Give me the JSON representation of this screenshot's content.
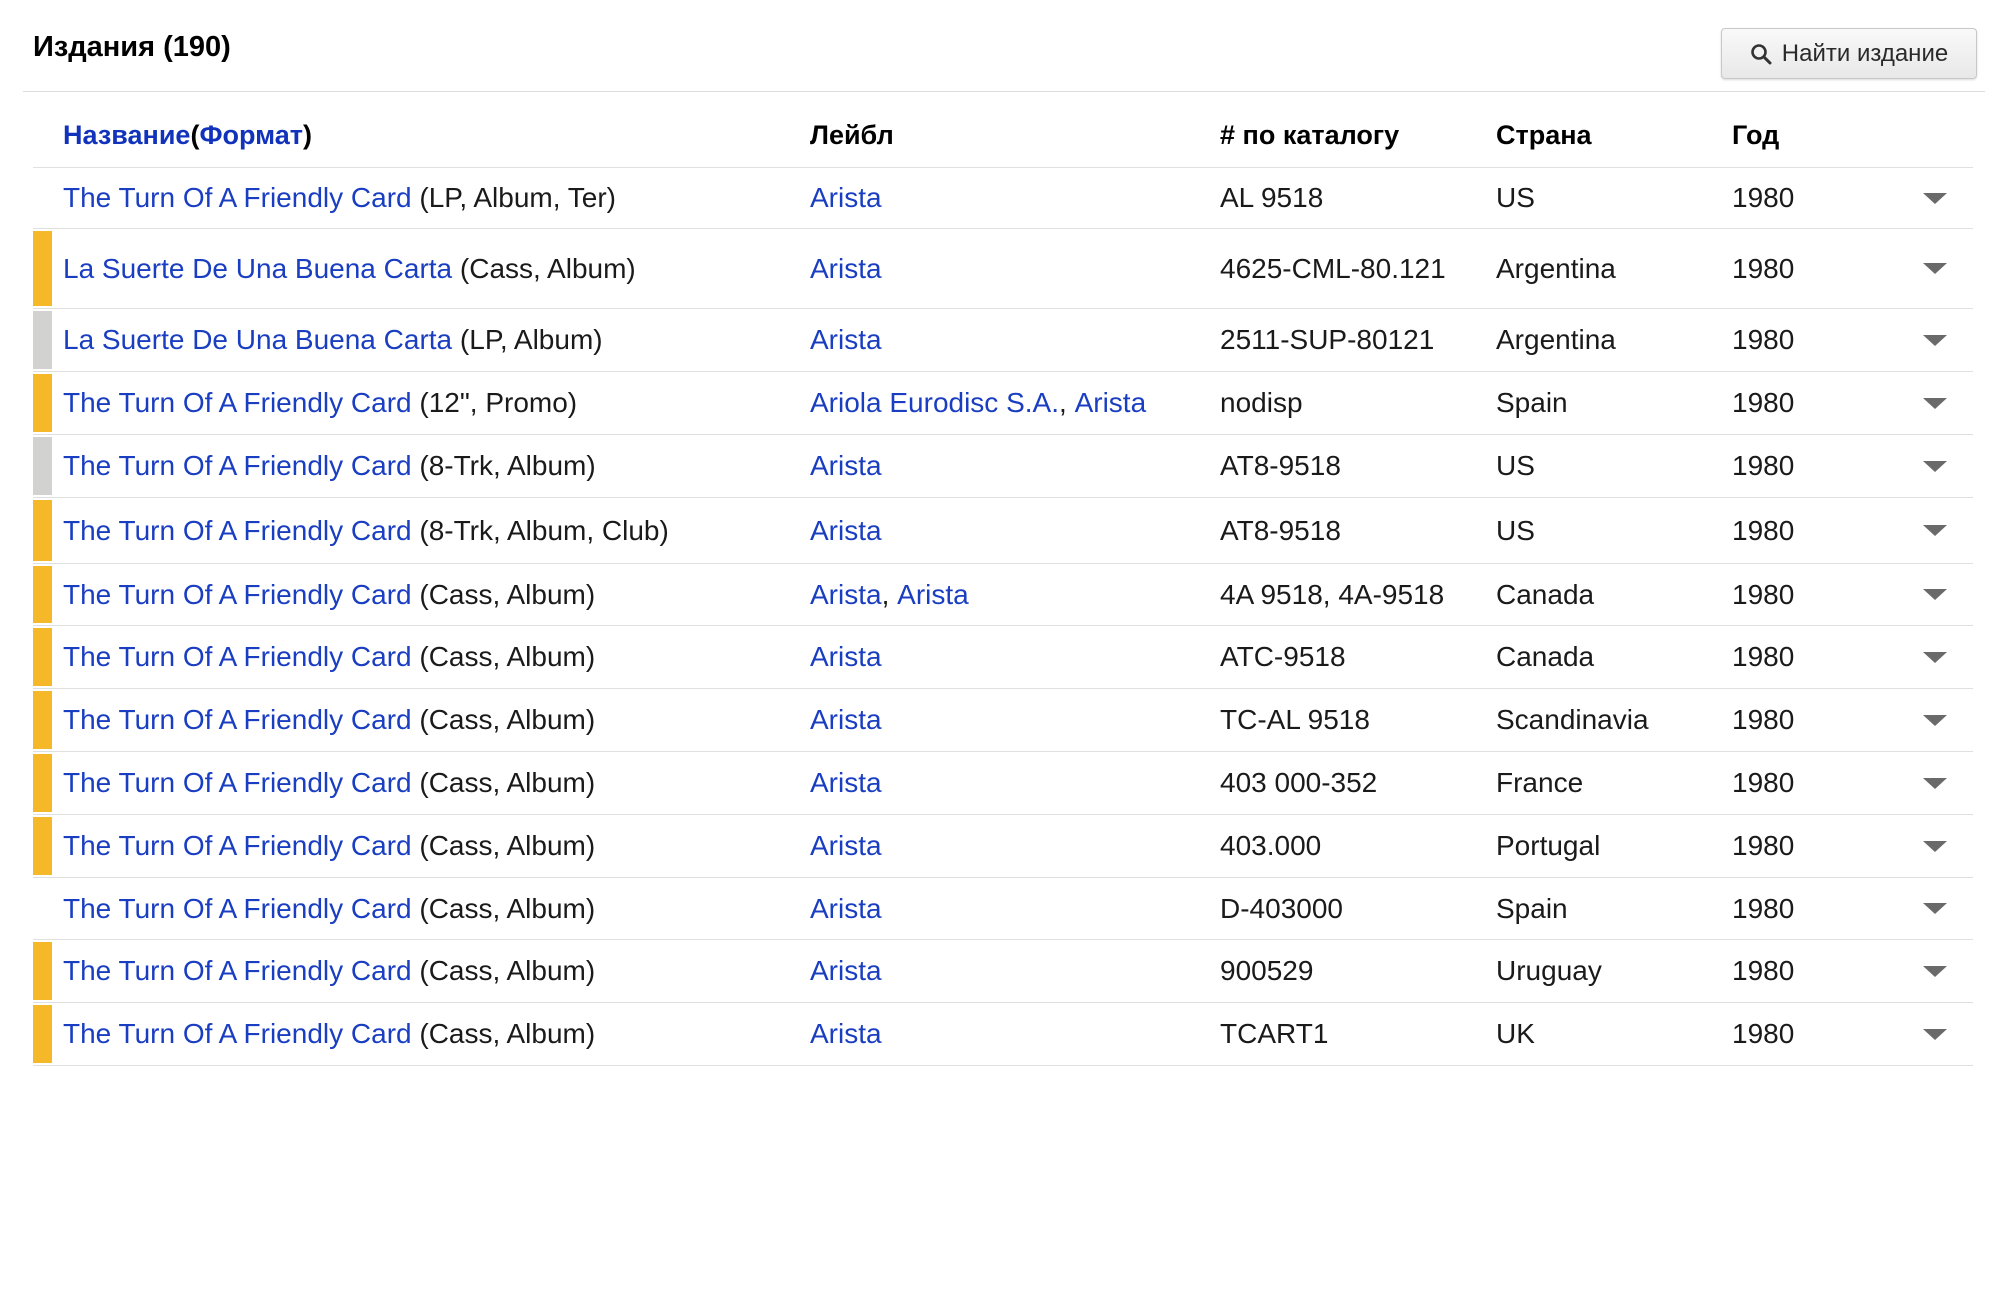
{
  "header": {
    "title": "Издания (190)",
    "find_button": "Найти издание",
    "find_icon": "search-icon"
  },
  "colors": {
    "link": "#1a3ec1",
    "stripe_yellow": "#f4b829",
    "stripe_gray": "#d2d2d0"
  },
  "columns": {
    "title": "Название",
    "title_open": " (",
    "format": "Формат",
    "title_close": ")",
    "label": "Лейбл",
    "catalog": "# по каталогу",
    "country": "Страна",
    "year": "Год"
  },
  "rows": [
    {
      "title": "The Turn Of A Friendly Card",
      "format": "(LP, Album, Ter)",
      "labels": [
        "Arista"
      ],
      "catalog": "AL 9518",
      "country": "US",
      "year": "1980",
      "stripe": "none"
    },
    {
      "title": "La Suerte De Una Buena Carta",
      "format": "(Cass, Album)",
      "labels": [
        "Arista"
      ],
      "catalog": "4625-CML-80.121",
      "country": "Argentina",
      "year": "1980",
      "stripe": "yellow"
    },
    {
      "title": "La Suerte De Una Buena Carta",
      "format": "(LP, Album)",
      "labels": [
        "Arista"
      ],
      "catalog": "2511-SUP-80121",
      "country": "Argentina",
      "year": "1980",
      "stripe": "gray"
    },
    {
      "title": "The Turn Of A Friendly Card",
      "format": "(12\", Promo)",
      "labels": [
        "Ariola Eurodisc S.A.",
        "Arista"
      ],
      "catalog": "nodisp",
      "country": "Spain",
      "year": "1980",
      "stripe": "yellow"
    },
    {
      "title": "The Turn Of A Friendly Card",
      "format": "(8-Trk, Album)",
      "labels": [
        "Arista"
      ],
      "catalog": "AT8-9518",
      "country": "US",
      "year": "1980",
      "stripe": "gray"
    },
    {
      "title": "The Turn Of A Friendly Card",
      "format": "(8-Trk, Album, Club)",
      "labels": [
        "Arista"
      ],
      "catalog": "AT8-9518",
      "country": "US",
      "year": "1980",
      "stripe": "yellow"
    },
    {
      "title": "The Turn Of A Friendly Card",
      "format": "(Cass, Album)",
      "labels": [
        "Arista",
        "Arista"
      ],
      "catalog": "4A 9518, 4A-9518",
      "country": "Canada",
      "year": "1980",
      "stripe": "yellow"
    },
    {
      "title": "The Turn Of A Friendly Card",
      "format": "(Cass, Album)",
      "labels": [
        "Arista"
      ],
      "catalog": "ATC-9518",
      "country": "Canada",
      "year": "1980",
      "stripe": "yellow"
    },
    {
      "title": "The Turn Of A Friendly Card",
      "format": "(Cass, Album)",
      "labels": [
        "Arista"
      ],
      "catalog": "TC-AL 9518",
      "country": "Scandinavia",
      "year": "1980",
      "stripe": "yellow"
    },
    {
      "title": "The Turn Of A Friendly Card",
      "format": "(Cass, Album)",
      "labels": [
        "Arista"
      ],
      "catalog": "403 000-352",
      "country": "France",
      "year": "1980",
      "stripe": "yellow"
    },
    {
      "title": "The Turn Of A Friendly Card",
      "format": "(Cass, Album)",
      "labels": [
        "Arista"
      ],
      "catalog": "403.000",
      "country": "Portugal",
      "year": "1980",
      "stripe": "yellow"
    },
    {
      "title": "The Turn Of A Friendly Card",
      "format": "(Cass, Album)",
      "labels": [
        "Arista"
      ],
      "catalog": "D-403000",
      "country": "Spain",
      "year": "1980",
      "stripe": "none"
    },
    {
      "title": "The Turn Of A Friendly Card",
      "format": "(Cass, Album)",
      "labels": [
        "Arista"
      ],
      "catalog": "900529",
      "country": "Uruguay",
      "year": "1980",
      "stripe": "yellow"
    },
    {
      "title": "The Turn Of A Friendly Card",
      "format": "(Cass, Album)",
      "labels": [
        "Arista"
      ],
      "catalog": "TCART1",
      "country": "UK",
      "year": "1980",
      "stripe": "yellow"
    }
  ]
}
